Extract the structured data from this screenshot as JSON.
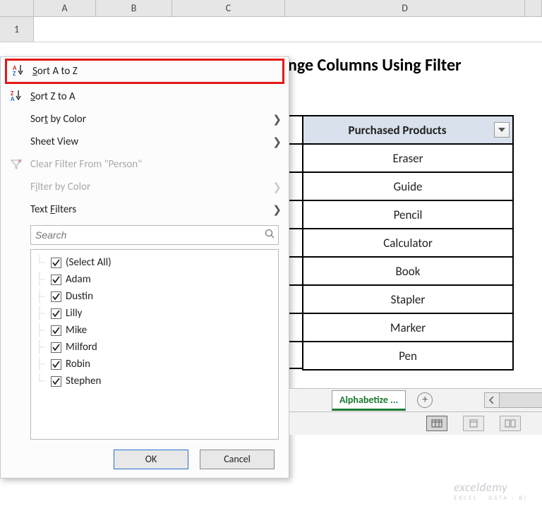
{
  "columns": {
    "A": "A",
    "B": "B",
    "C": "C",
    "D": "D"
  },
  "row1_label": "1",
  "title_fragment": "nge Columns Using Filter",
  "table": {
    "header": "Purchased Products",
    "rows": [
      "Eraser",
      "Guide",
      "Pencil",
      "Calculator",
      "Book",
      "Stapler",
      "Marker",
      "Pen"
    ]
  },
  "menu": {
    "sort_az": "Sort A to Z",
    "sort_za": "Sort Z to A",
    "sort_color": "Sort by Color",
    "sheet_view": "Sheet View",
    "clear_filter": "Clear Filter From \"Person\"",
    "filter_color": "Filter by Color",
    "text_filters": "Text Filters",
    "search_placeholder": "Search",
    "items": [
      "(Select All)",
      "Adam",
      "Dustin",
      "Lilly",
      "Mike",
      "Milford",
      "Robin",
      "Stephen"
    ],
    "ok": "OK",
    "cancel": "Cancel"
  },
  "sheet_tab": "Alphabetize ...",
  "watermark": {
    "name": "exceldemy",
    "sub": "EXCEL · DATA · BI"
  }
}
